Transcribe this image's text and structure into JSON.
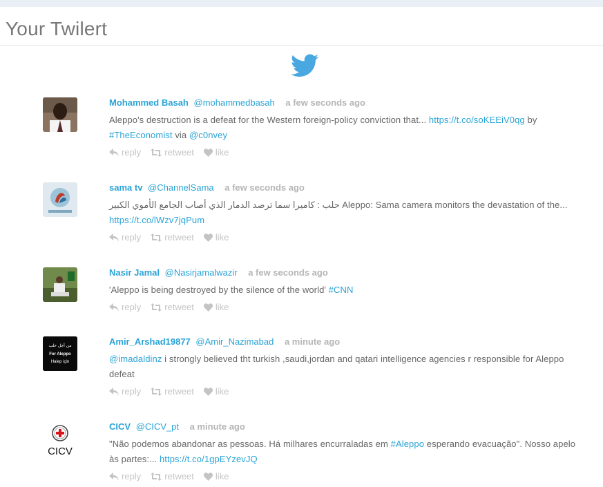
{
  "header": {
    "title": "Your Twilert"
  },
  "colors": {
    "accent": "#2aa3d6",
    "muted": "#b5b5b5",
    "bird": "#4aa8e0"
  },
  "actions": {
    "reply": "reply",
    "retweet": "retweet",
    "like": "like"
  },
  "tweets": [
    {
      "name": "Mohammed Basah",
      "handle": "@mohammedbasah",
      "time": "a few seconds ago",
      "t1": "Aleppo's destruction is a defeat for the Western foreign-policy conviction that... ",
      "l1": "https://t.co/soKEEiV0qg",
      "t2": " by ",
      "l2": "#TheEconomist",
      "t3": " via ",
      "l3": "@c0nvey",
      "avatar": "person-avatar"
    },
    {
      "name": "sama tv",
      "handle": "@ChannelSama",
      "time": "a few seconds ago",
      "t1": "حلب : كاميرا سما ترصد الدمار الذي أصاب الجامع الأموي الكبير Aleppo: Sama camera monitors the devastation of the... ",
      "l1": "https://t.co/lWzv7jqPum",
      "t2": "",
      "l2": "",
      "t3": "",
      "l3": "",
      "avatar": "channel-logo-avatar"
    },
    {
      "name": "Nasir Jamal",
      "handle": "@Nasirjamalwazir",
      "time": "a few seconds ago",
      "t1": "'Aleppo is being destroyed by the silence of the world' ",
      "l1": "#CNN",
      "t2": "",
      "l2": "",
      "t3": "",
      "l3": "",
      "avatar": "person-seated-avatar"
    },
    {
      "name": "Amir_Arshad19877",
      "handle": "@Amir_Nazimabad",
      "time": "a minute ago",
      "l0": "@imadaldinz",
      "t1": " i strongly believed tht turkish ,saudi,jordan and qatari intelligence agencies r responsible for Aleppo defeat",
      "l1": "",
      "t2": "",
      "l2": "",
      "t3": "",
      "l3": "",
      "avatar": "for-aleppo-avatar",
      "avatar_text": [
        "من أجل حلب",
        "For Aleppo",
        "Halep için"
      ]
    },
    {
      "name": "CICV",
      "handle": "@CICV_pt",
      "time": "a minute ago",
      "t1": "\"Não podemos abandonar as pessoas. Há milhares encurraladas em ",
      "l1": "#Aleppo",
      "t2": " esperando evacuação\". Nosso apelo às partes:... ",
      "l2": "https://t.co/1gpEYzevJQ",
      "t3": "",
      "l3": "",
      "avatar": "cicv-logo-avatar",
      "avatar_text": [
        "CICV"
      ]
    }
  ]
}
